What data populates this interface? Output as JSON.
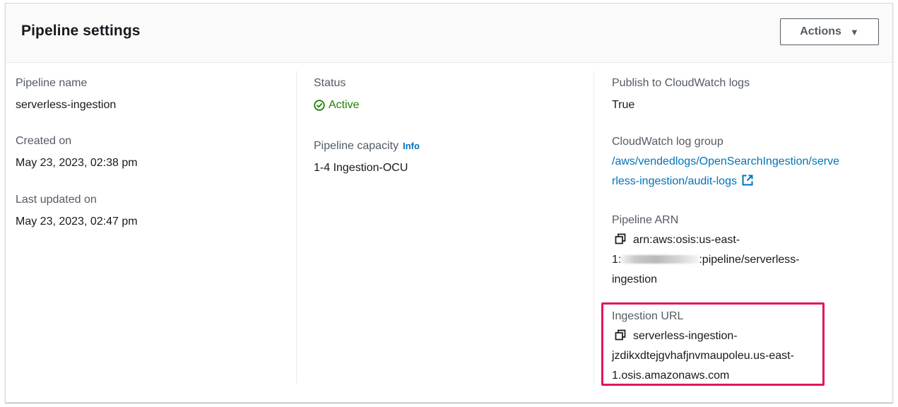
{
  "header": {
    "title": "Pipeline settings",
    "actions_label": "Actions",
    "actions_caret": "▼"
  },
  "col1": {
    "pipeline_name_label": "Pipeline name",
    "pipeline_name_value": "serverless-ingestion",
    "created_label": "Created on",
    "created_value": "May 23, 2023, 02:38 pm",
    "updated_label": "Last updated on",
    "updated_value": "May 23, 2023, 02:47 pm"
  },
  "col2": {
    "status_label": "Status",
    "status_value": "Active",
    "capacity_label": "Pipeline capacity",
    "capacity_info": "Info",
    "capacity_value": "1-4 Ingestion-OCU"
  },
  "col3": {
    "cloudwatch_label": "Publish to CloudWatch logs",
    "cloudwatch_value": "True",
    "log_group_label": "CloudWatch log group",
    "log_group_line1": "/aws/vendedlogs/OpenSearchIngestion/serve",
    "log_group_line2": "rless-ingestion/audit-logs",
    "arn_label": "Pipeline ARN",
    "arn_line1": "arn:aws:osis:us-east-",
    "arn_line2_prefix": "1:",
    "arn_line2_suffix": ":pipeline/serverless-",
    "arn_line3": "ingestion",
    "url_label": "Ingestion URL",
    "url_line1": "serverless-ingestion-",
    "url_line2": "jzdikxdtejgvhafjnvmaupoleu.us-east-",
    "url_line3": "1.osis.amazonaws.com"
  },
  "colors": {
    "link": "#0073bb",
    "status_active": "#1d8102",
    "highlight": "#e3165b"
  },
  "icons": [
    "caret-down-icon",
    "check-circle-icon",
    "external-link-icon",
    "copy-icon"
  ]
}
